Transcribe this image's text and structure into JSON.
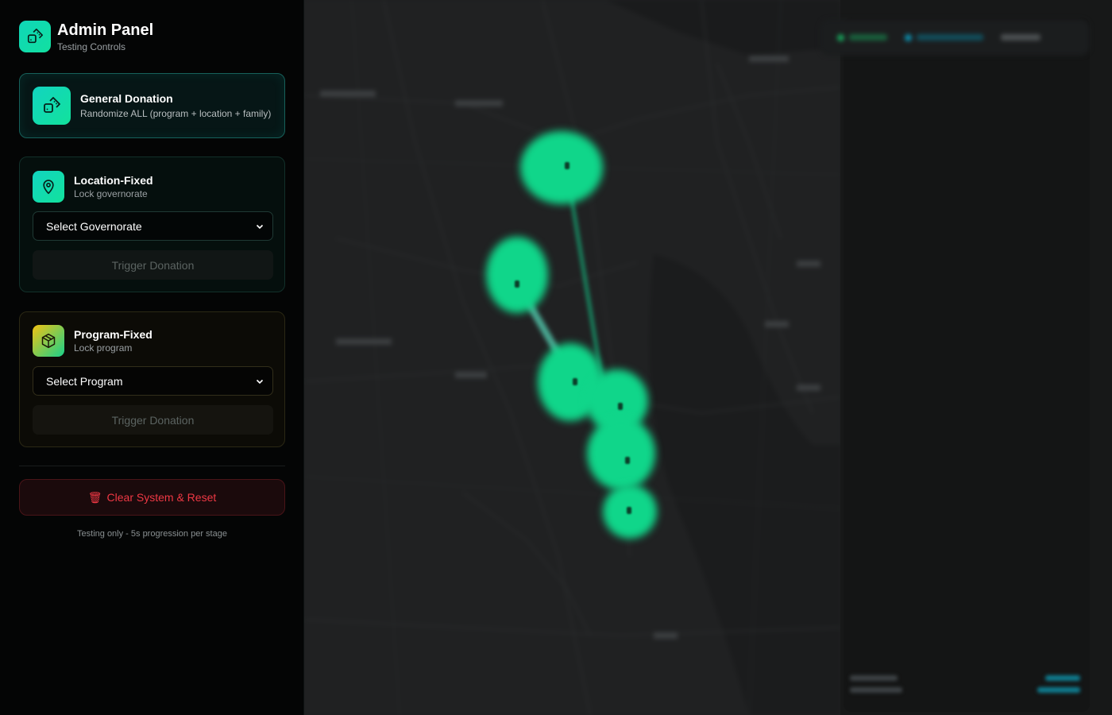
{
  "header": {
    "title": "Admin Panel",
    "subtitle": "Testing Controls"
  },
  "general": {
    "title": "General Donation",
    "description": "Randomize ALL (program + location + family)"
  },
  "location": {
    "title": "Location-Fixed",
    "description": "Lock governorate",
    "select_value": "Select Governorate",
    "trigger_label": "Trigger Donation"
  },
  "program": {
    "title": "Program-Fixed",
    "description": "Lock program",
    "select_value": "Select Program",
    "trigger_label": "Trigger Donation"
  },
  "actions": {
    "clear_icon": "🗑",
    "clear_label": "Clear System & Reset"
  },
  "footnote": "Testing only - 5s progression per stage",
  "colors": {
    "accent_teal": "#12e0a0",
    "accent_gold": "#f2c313",
    "danger": "#ee3844",
    "map_marker": "#10d68a"
  },
  "icons": {
    "logo": "dice-icon",
    "general": "dice-icon",
    "location": "map-pin-icon",
    "program": "package-icon",
    "select_caret": "chevron-down-icon",
    "clear": "trash-icon"
  }
}
